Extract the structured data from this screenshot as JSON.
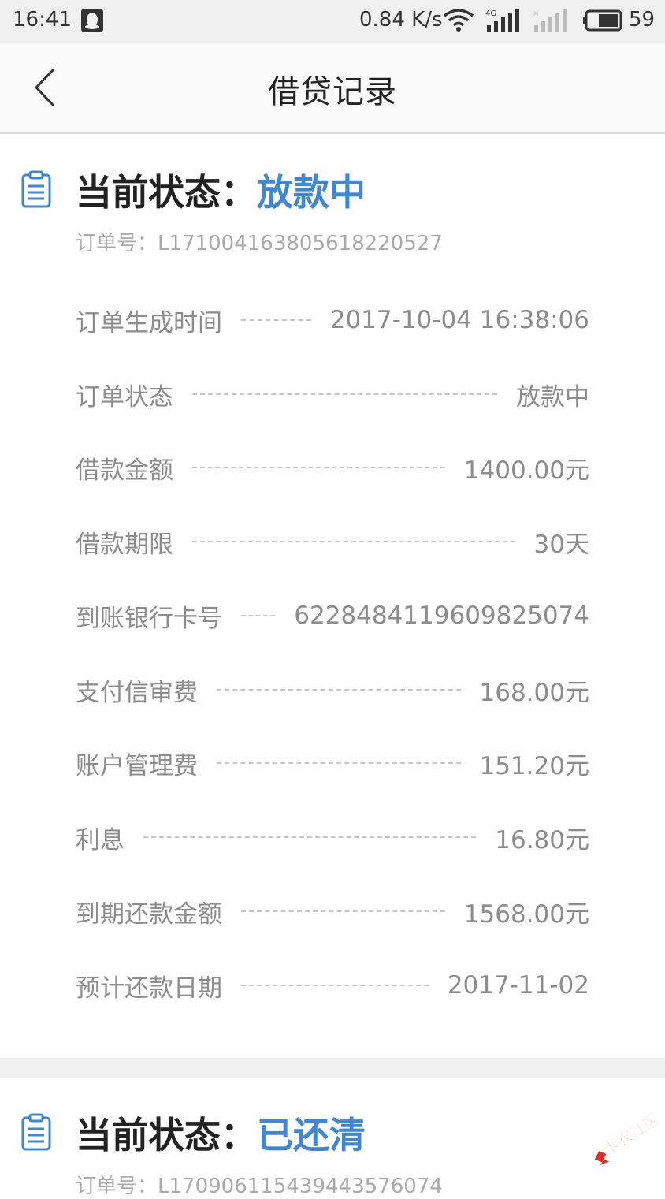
{
  "status_bar": {
    "time": "16:41",
    "net_speed": "0.84 K/s",
    "battery": "59",
    "icons": [
      "qq-icon",
      "wifi-icon",
      "signal-4g-icon",
      "signal-icon",
      "battery-icon"
    ]
  },
  "nav": {
    "title": "借贷记录",
    "back_icon": "chevron-left-icon"
  },
  "records": [
    {
      "status_label": "当前状态：",
      "status_value": "放款中",
      "order_no": "订单号：L171004163805618220527",
      "fields": [
        {
          "label": "订单生成时间",
          "value": "2017-10-04 16:38:06"
        },
        {
          "label": "订单状态",
          "value": "放款中"
        },
        {
          "label": "借款金额",
          "value": "1400.00元"
        },
        {
          "label": "借款期限",
          "value": "30天"
        },
        {
          "label": "到账银行卡号",
          "value": "6228484119609825074"
        },
        {
          "label": "支付信审费",
          "value": "168.00元"
        },
        {
          "label": "账户管理费",
          "value": "151.20元"
        },
        {
          "label": "利息",
          "value": "16.80元"
        },
        {
          "label": "到期还款金额",
          "value": "1568.00元"
        },
        {
          "label": "预计还款日期",
          "value": "2017-11-02"
        }
      ]
    },
    {
      "status_label": "当前状态：",
      "status_value": "已还清",
      "order_no": "订单号：L170906115439443576074"
    }
  ],
  "watermark": "卡农社区",
  "colors": {
    "accent": "#3f86d4",
    "label_text": "#8c8c8c",
    "page_bg": "#f0f0f0"
  }
}
